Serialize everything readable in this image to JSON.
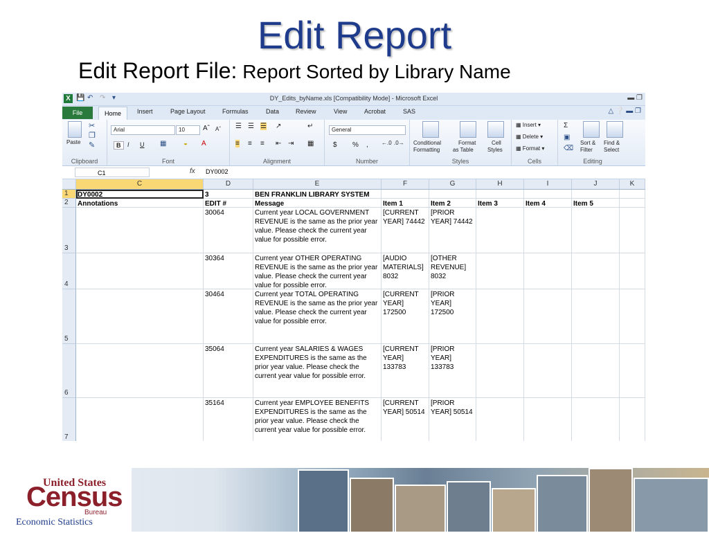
{
  "slide": {
    "title": "Edit Report",
    "subtitle_main": "Edit Report File:",
    "subtitle_rest": " Report Sorted by Library Name"
  },
  "excel": {
    "window_title": "DY_Edits_byName.xls  [Compatibility Mode]  -  Microsoft Excel",
    "tabs": [
      "File",
      "Home",
      "Insert",
      "Page Layout",
      "Formulas",
      "Data",
      "Review",
      "View",
      "Acrobat",
      "SAS"
    ],
    "ribbon": {
      "clipboard": {
        "label": "Clipboard",
        "paste": "Paste"
      },
      "font": {
        "label": "Font",
        "font_name": "Arial",
        "font_size": "10",
        "bold": "B",
        "italic": "I",
        "underline": "U"
      },
      "alignment": {
        "label": "Alignment"
      },
      "number": {
        "label": "Number",
        "format": "General",
        "currency": "$",
        "percent": "%",
        "comma": ","
      },
      "styles": {
        "label": "Styles",
        "conditional": "Conditional",
        "conditional2": "Formatting",
        "format_table": "Format",
        "format_table2": "as Table",
        "cell_styles": "Cell",
        "cell_styles2": "Styles"
      },
      "cells": {
        "label": "Cells",
        "insert": "Insert",
        "delete": "Delete",
        "format": "Format"
      },
      "editing": {
        "label": "Editing",
        "sigma": "Σ",
        "sort": "Sort &",
        "sort2": "Filter",
        "find": "Find &",
        "find2": "Select"
      }
    },
    "name_box": "C1",
    "fx": "fx",
    "formula": "DY0002",
    "columns": [
      "C",
      "D",
      "E",
      "F",
      "G",
      "H",
      "I",
      "J",
      "K"
    ],
    "rows": [
      {
        "num": "1",
        "cells": [
          "DY0002",
          "3",
          "BEN FRANKLIN LIBRARY SYSTEM",
          "",
          "",
          "",
          "",
          ""
        ]
      },
      {
        "num": "2",
        "cells": [
          "Annotations",
          "EDIT #",
          "Message",
          "Item 1",
          "Item 2",
          "Item 3",
          "Item 4",
          "Item 5"
        ]
      },
      {
        "num": "3",
        "cells": [
          "",
          "30064",
          "Current year LOCAL GOVERNMENT REVENUE is the same as the prior year value.  Please check the current year value for possible error.",
          "[CURRENT YEAR] 74442",
          "[PRIOR YEAR] 74442",
          "",
          "",
          ""
        ]
      },
      {
        "num": "4",
        "cells": [
          "",
          "30364",
          "Current year OTHER OPERATING REVENUE is the same as the prior year value.  Please check the current year value for possible error.",
          "[AUDIO MATERIALS] 8032",
          "[OTHER REVENUE] 8032",
          "",
          "",
          ""
        ]
      },
      {
        "num": "5",
        "cells": [
          "",
          "30464",
          "Current year TOTAL OPERATING REVENUE is the same as the prior year value.  Please check the current year value for possible error.",
          "[CURRENT YEAR] 172500",
          "[PRIOR YEAR] 172500",
          "",
          "",
          ""
        ]
      },
      {
        "num": "6",
        "cells": [
          "",
          "35064",
          "Current year SALARIES & WAGES EXPENDITURES is the same as the prior year value.  Please check the current year value for possible error.",
          "[CURRENT YEAR] 133783",
          "[PRIOR YEAR] 133783",
          "",
          "",
          ""
        ]
      },
      {
        "num": "7",
        "cells": [
          "",
          "35164",
          "Current year EMPLOYEE BENEFITS EXPENDITURES is the same as the prior year value.  Please check the current year value for possible error.",
          "[CURRENT YEAR] 50514",
          "[PRIOR YEAR] 50514",
          "",
          "",
          ""
        ]
      }
    ]
  },
  "footer": {
    "logo_top": "United States",
    "logo_main": "Census",
    "logo_bureau": "Bureau",
    "division": "Economic Statistics"
  }
}
